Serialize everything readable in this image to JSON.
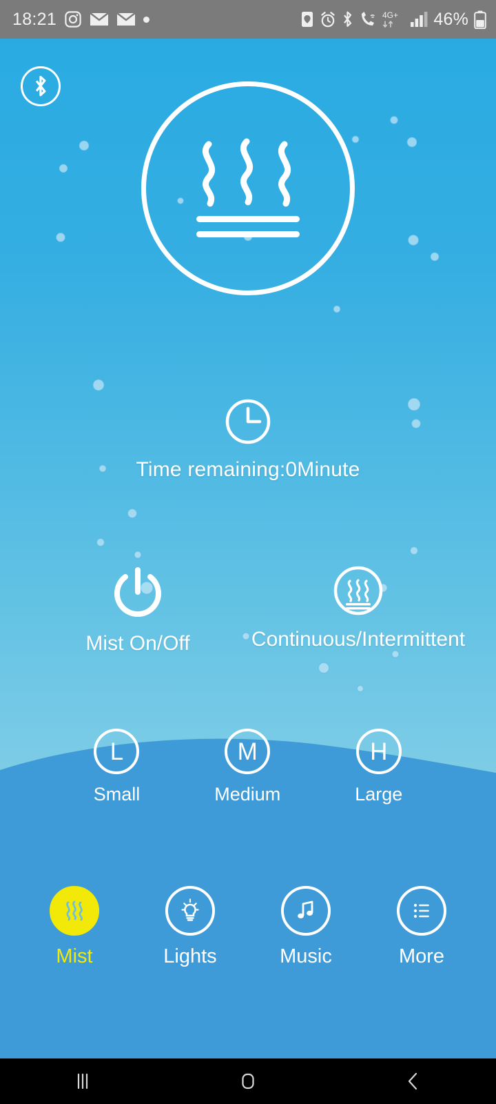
{
  "status_bar": {
    "time": "18:21",
    "battery_percent": "46%",
    "network": "4G+",
    "left_icons": [
      "instagram-icon",
      "mail-icon",
      "mail-icon",
      "dot-icon"
    ],
    "right_icons": [
      "battery-saver-icon",
      "alarm-icon",
      "bluetooth-icon",
      "call-wifi-icon",
      "network-4gplus-icon",
      "signal-bars-icon",
      "battery-icon"
    ],
    "bg_color": "#7b7b7b"
  },
  "app": {
    "bluetooth_badge": "bluetooth-icon",
    "hero_icon": "mist-steam-icon",
    "timer": {
      "icon": "clock-icon",
      "label": "Time remaining:0Minute"
    },
    "controls": [
      {
        "icon": "power-icon",
        "label": "Mist On/Off"
      },
      {
        "icon": "mist-steam-icon",
        "label": "Continuous/Intermittent"
      }
    ],
    "mist_levels": [
      {
        "letter": "L",
        "label": "Small"
      },
      {
        "letter": "M",
        "label": "Medium"
      },
      {
        "letter": "H",
        "label": "Large"
      }
    ],
    "tabs": [
      {
        "icon": "mist-steam-icon",
        "label": "Mist",
        "active": true
      },
      {
        "icon": "lightbulb-icon",
        "label": "Lights",
        "active": false
      },
      {
        "icon": "music-note-icon",
        "label": "Music",
        "active": false
      },
      {
        "icon": "list-icon",
        "label": "More",
        "active": false
      }
    ],
    "colors": {
      "sky_top": "#29ABE2",
      "sky_bottom": "#9fd8ea",
      "water": "#3E9BD8",
      "accent": "#f2e909"
    }
  },
  "nav_bar": {
    "buttons": [
      "recents-icon",
      "home-icon",
      "back-icon"
    ]
  }
}
